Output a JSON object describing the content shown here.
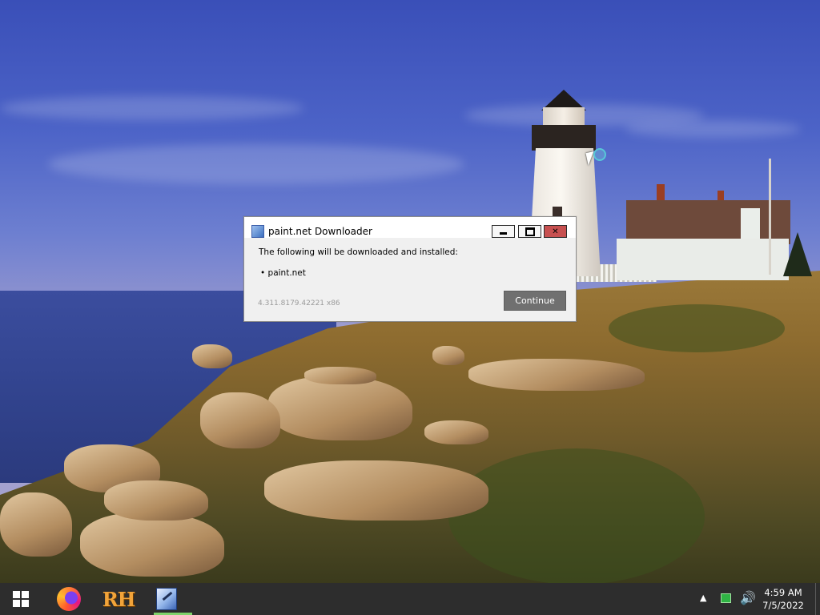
{
  "dialog": {
    "title": "paint.net Downloader",
    "intro_text": "The following will be downloaded and installed:",
    "items": [
      "• paint.net"
    ],
    "version_text": "4.311.8179.42221 x86",
    "continue_label": "Continue",
    "close_glyph": "✕"
  },
  "taskbar": {
    "apps": [
      {
        "name": "firefox",
        "icon": "firefox-icon"
      },
      {
        "name": "rh",
        "icon": "rh-icon",
        "label": "RH"
      },
      {
        "name": "paint.net",
        "icon": "paintnet-icon",
        "active": true
      }
    ],
    "tray": {
      "chevron": "▲",
      "volume_glyph": "🔊"
    },
    "clock": {
      "time": "4:59 AM",
      "date": "7/5/2022"
    }
  },
  "colors": {
    "taskbar_bg": "#2d2d2d",
    "close_button": "#c75050",
    "continue_button": "#707070",
    "active_indicator": "#7fd36b"
  }
}
